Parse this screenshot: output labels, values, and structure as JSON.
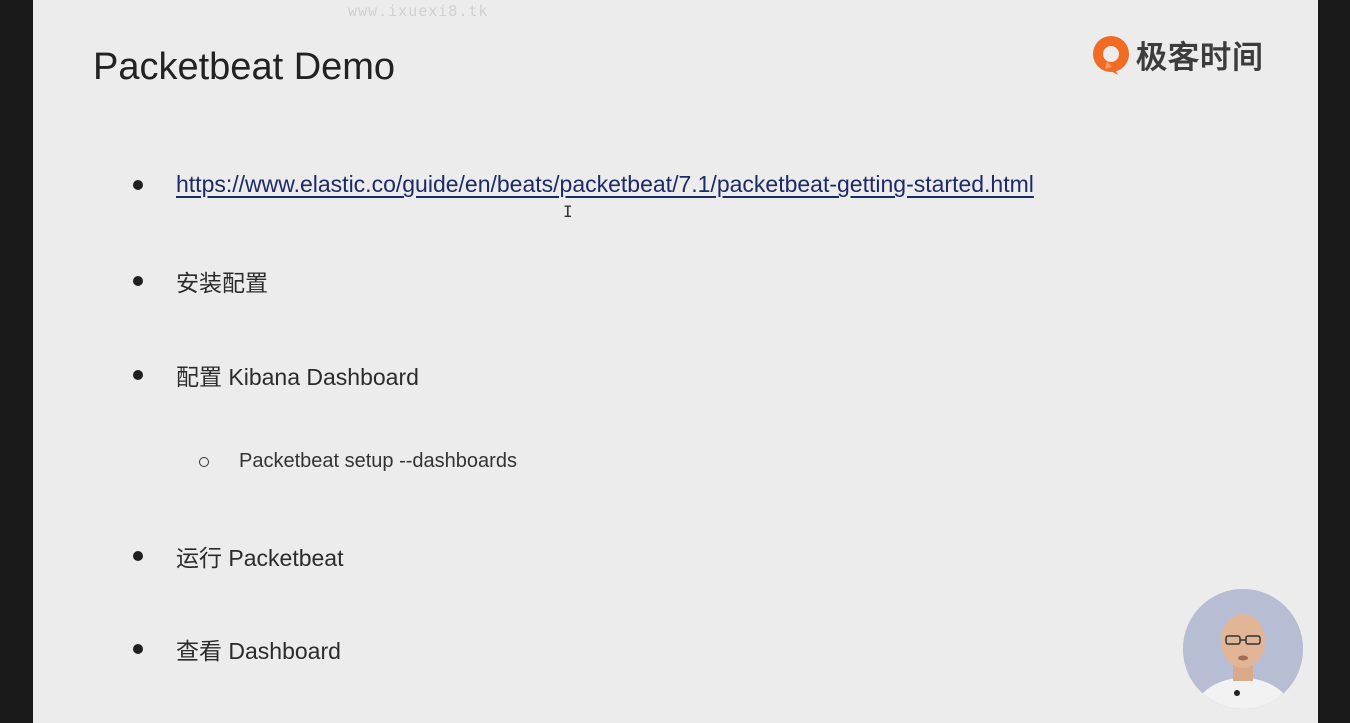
{
  "watermark": "www.ixuexi8.tk",
  "slide": {
    "title": "Packetbeat Demo",
    "logo_text": "极客时间",
    "bullets": [
      {
        "text": "https://www.elastic.co/guide/en/beats/packetbeat/7.1/packetbeat-getting-started.html",
        "is_link": true
      },
      {
        "text": "安装配置"
      },
      {
        "text": "配置 Kibana Dashboard"
      },
      {
        "text": "Packetbeat setup --dashboards",
        "sub": true
      },
      {
        "text": "运行 Packetbeat"
      },
      {
        "text": "查看 Dashboard"
      }
    ]
  },
  "colors": {
    "slide_bg": "#ececec",
    "link": "#1d2a66",
    "logo_orange": "#f06b24"
  },
  "icons": {
    "logo": "geektime-logo-icon",
    "cursor": "text-cursor-icon",
    "presenter": "presenter-avatar"
  }
}
